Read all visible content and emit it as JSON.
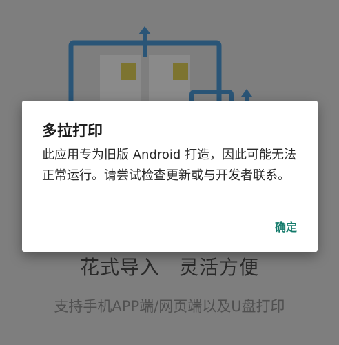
{
  "dialog": {
    "title": "多拉打印",
    "message": "此应用专为旧版 Android 打造，因此可能无法正常运行。请尝试检查更新或与开发者联系。",
    "ok_label": "确定"
  },
  "background": {
    "feature_title_left": "花式导入",
    "feature_title_right": "灵活方便",
    "feature_subtitle": "支持手机APP端/网页端以及U盘打印"
  },
  "colors": {
    "accent": "#127a6a",
    "illustration_blue": "#2a5577",
    "illustration_yellow": "#7d7430"
  }
}
